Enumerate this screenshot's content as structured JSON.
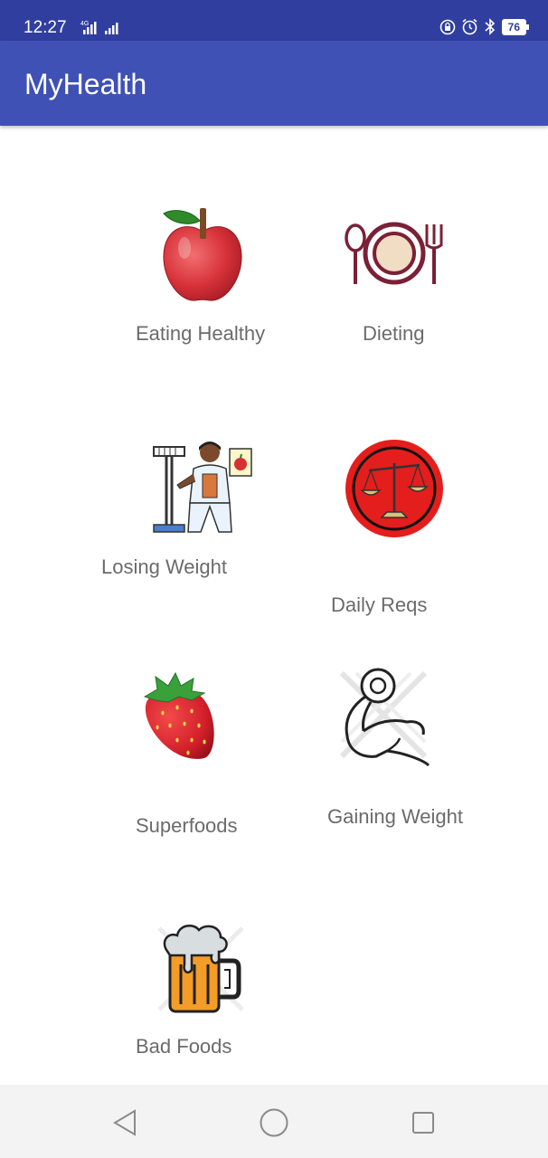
{
  "status_bar": {
    "time": "12:27",
    "network_type": "4G",
    "battery_level": "76"
  },
  "app_bar": {
    "title": "MyHealth"
  },
  "menu": {
    "eating_healthy": {
      "label": "Eating Healthy",
      "icon": "apple-icon"
    },
    "dieting": {
      "label": "Dieting",
      "icon": "plate-utensils-icon"
    },
    "losing_weight": {
      "label": "Losing Weight",
      "icon": "weigh-scale-nurse-icon"
    },
    "daily_reqs": {
      "label": "Daily Reqs",
      "icon": "balance-scale-icon"
    },
    "superfoods": {
      "label": "Superfoods",
      "icon": "strawberry-icon"
    },
    "gaining_weight": {
      "label": "Gaining Weight",
      "icon": "flexed-arm-icon"
    },
    "bad_foods": {
      "label": "Bad Foods",
      "icon": "beer-mug-icon"
    }
  },
  "colors": {
    "status_bar": "#303f9f",
    "app_bar": "#3f51b5",
    "label_text": "#6b6b6b",
    "nav_bar": "#f3f3f3"
  }
}
